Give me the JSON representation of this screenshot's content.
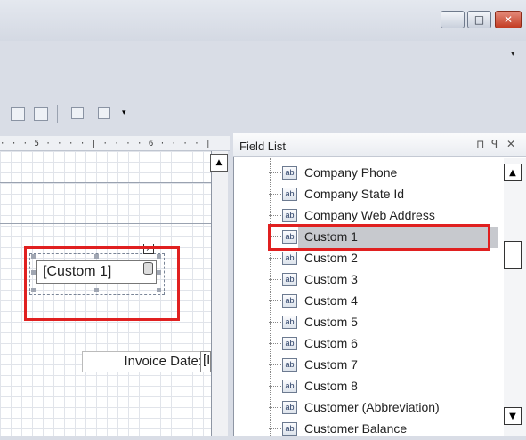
{
  "window": {
    "minimize_glyph": "–",
    "maximize_glyph": "□",
    "close_glyph": "✕",
    "menu_arrow": "▾"
  },
  "ruler": {
    "ticks": "· · · 5 · · · · | · · · · 6 · · · · |"
  },
  "canvas": {
    "custom_field": "[Custom 1]",
    "invoice_date_label": "Invoice Date:",
    "invoice_field_partial": "[I"
  },
  "field_list": {
    "title": "Field List",
    "pin_glyph": "⊓",
    "auto_hide_glyph": "ꟼ",
    "close_glyph": "✕",
    "items": [
      {
        "label": "Company Phone",
        "icon": "ab"
      },
      {
        "label": "Company State Id",
        "icon": "ab"
      },
      {
        "label": "Company Web Address",
        "icon": "ab"
      },
      {
        "label": "Custom 1",
        "icon": "ab"
      },
      {
        "label": "Custom 2",
        "icon": "ab"
      },
      {
        "label": "Custom 3",
        "icon": "ab"
      },
      {
        "label": "Custom 4",
        "icon": "ab"
      },
      {
        "label": "Custom 5",
        "icon": "ab"
      },
      {
        "label": "Custom 6",
        "icon": "ab"
      },
      {
        "label": "Custom 7",
        "icon": "ab"
      },
      {
        "label": "Custom 8",
        "icon": "ab"
      },
      {
        "label": "Customer (Abbreviation)",
        "icon": "ab"
      },
      {
        "label": "Customer Balance",
        "icon": "ab"
      }
    ],
    "selected_item": "Custom 1"
  },
  "scroll": {
    "up_glyph": "▲",
    "down_glyph": "▼"
  },
  "colors": {
    "highlight_red": "#e02020",
    "selection_gray": "#c7c9ce"
  }
}
